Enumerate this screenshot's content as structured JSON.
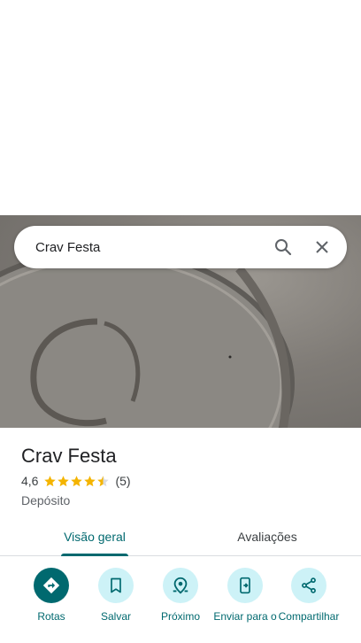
{
  "search": {
    "query": "Crav Festa"
  },
  "place": {
    "name": "Crav Festa",
    "rating": "4,6",
    "stars": 4.5,
    "review_count": "(5)",
    "category": "Depósito"
  },
  "tabs": [
    {
      "label": "Visão geral",
      "active": true
    },
    {
      "label": "Avaliações",
      "active": false
    }
  ],
  "actions": [
    {
      "label": "Rotas",
      "icon": "directions-icon"
    },
    {
      "label": "Salvar",
      "icon": "bookmark-icon"
    },
    {
      "label": "Próximo",
      "icon": "nearby-icon"
    },
    {
      "label": "Enviar para o",
      "icon": "send-to-phone-icon"
    },
    {
      "label": "Compartilhar",
      "icon": "share-icon"
    }
  ],
  "colors": {
    "accent": "#00696f",
    "action_bg": "#cdf2f7",
    "star": "#f4b400"
  }
}
